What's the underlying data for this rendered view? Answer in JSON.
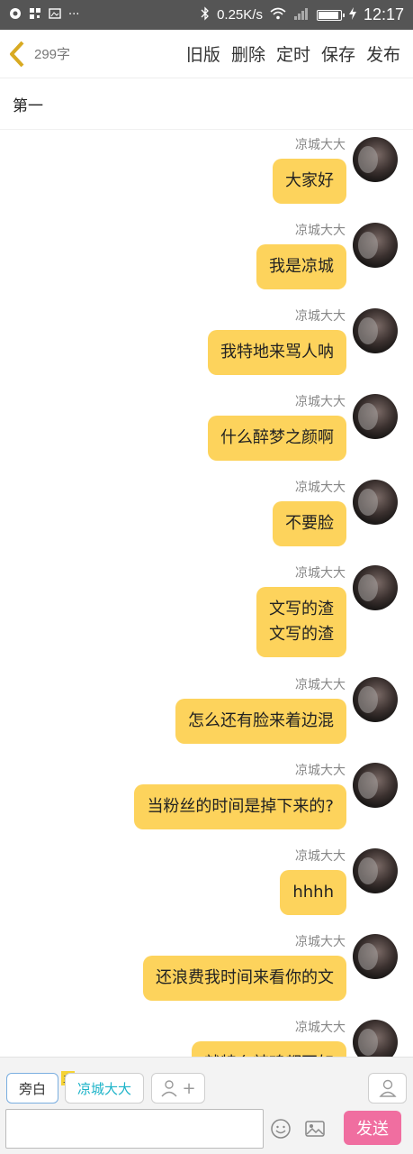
{
  "status_bar": {
    "speed": "0.25K/s",
    "time": "12:17",
    "dots": "···"
  },
  "top_bar": {
    "word_count": "299字",
    "actions": [
      "旧版",
      "删除",
      "定时",
      "保存",
      "发布"
    ]
  },
  "chapter_title": "第一",
  "messages": [
    {
      "name": "凉城大大",
      "text": "大家好"
    },
    {
      "name": "凉城大大",
      "text": "我是凉城"
    },
    {
      "name": "凉城大大",
      "text": "我特地来骂人呐"
    },
    {
      "name": "凉城大大",
      "text": "什么醉梦之颜啊"
    },
    {
      "name": "凉城大大",
      "text": "不要脸"
    },
    {
      "name": "凉城大大",
      "text": "文写的渣\n文写的渣"
    },
    {
      "name": "凉城大大",
      "text": "怎么还有脸来着边混"
    },
    {
      "name": "凉城大大",
      "text": "当粉丝的时间是掉下来的?"
    },
    {
      "name": "凉城大大",
      "text": "hhhh"
    },
    {
      "name": "凉城大大",
      "text": "还浪费我时间来看你的文"
    },
    {
      "name": "凉城大大",
      "text": "就特么辣鸡都不如"
    }
  ],
  "bottom_bar": {
    "narration_label": "旁白",
    "main_badge": "主",
    "role_label": "凉城大大",
    "add_symbol": "+",
    "input_placeholder": "",
    "send_label": "发送"
  }
}
